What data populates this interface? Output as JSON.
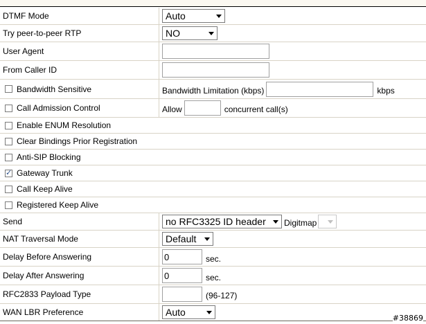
{
  "rows": {
    "dtmf_mode": {
      "label": "DTMF Mode",
      "value": "Auto"
    },
    "peer_rtp": {
      "label": "Try peer-to-peer RTP",
      "value": "NO"
    },
    "user_agent": {
      "label": "User Agent",
      "value": ""
    },
    "from_caller_id": {
      "label": "From Caller ID",
      "value": ""
    },
    "bandwidth_sensitive": {
      "label": "Bandwidth Sensitive",
      "checked": false,
      "limit_label": "Bandwidth Limitation (kbps)",
      "limit_value": "",
      "unit": "kbps"
    },
    "call_admission": {
      "label": "Call Admission Control",
      "checked": false,
      "allow_label": "Allow",
      "allow_value": "",
      "suffix": "concurrent call(s)"
    },
    "enum_resolution": {
      "label": "Enable ENUM Resolution",
      "checked": false
    },
    "clear_bindings": {
      "label": "Clear Bindings Prior Registration",
      "checked": false
    },
    "anti_sip": {
      "label": "Anti-SIP Blocking",
      "checked": false
    },
    "gateway_trunk": {
      "label": "Gateway Trunk",
      "checked": true
    },
    "call_keep_alive": {
      "label": "Call Keep Alive",
      "checked": false
    },
    "registered_keep_alive": {
      "label": "Registered Keep Alive",
      "checked": false
    },
    "send": {
      "label": "Send",
      "value": "no RFC3325 ID header",
      "digitmap_label": "Digitmap",
      "digitmap_value": ""
    },
    "nat_traversal": {
      "label": "NAT Traversal Mode",
      "value": "Default"
    },
    "delay_before": {
      "label": "Delay Before Answering",
      "value": "0",
      "unit": "sec."
    },
    "delay_after": {
      "label": "Delay After Answering",
      "value": "0",
      "unit": "sec."
    },
    "rfc2833": {
      "label": "RFC2833 Payload Type",
      "value": "",
      "range": "(96-127)"
    },
    "wan_lbr": {
      "label": "WAN LBR Preference",
      "value": "Auto"
    }
  },
  "watermark": "#38869",
  "colors": {
    "row_border": "#d8d3c6",
    "bottom_border": "#6a665c",
    "check_color": "#2a4f8a"
  }
}
